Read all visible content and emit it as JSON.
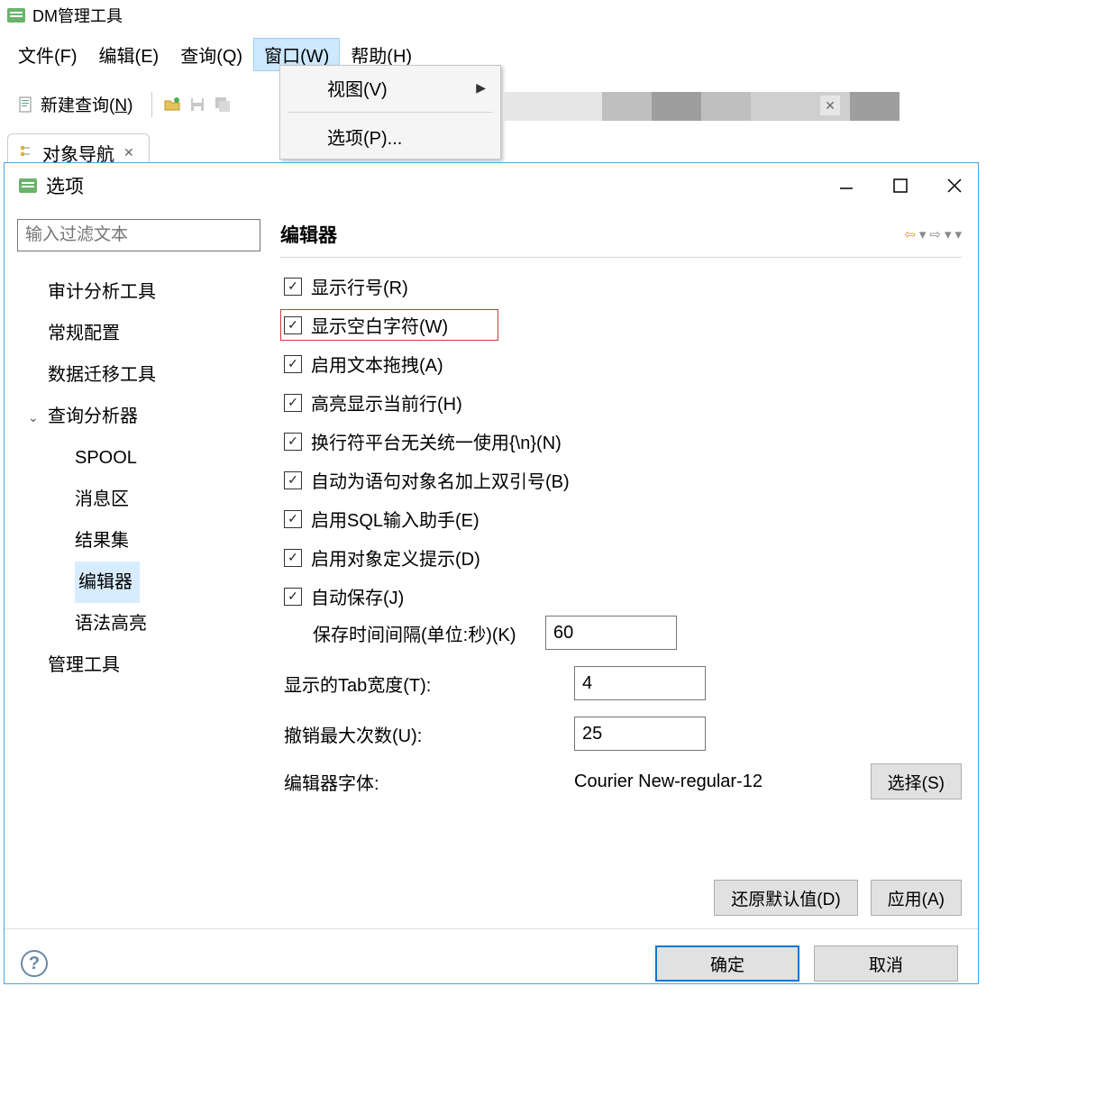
{
  "app": {
    "title": "DM管理工具"
  },
  "menu": {
    "file": "文件(F)",
    "edit": "编辑(E)",
    "query": "查询(Q)",
    "window": "窗口(W)",
    "help": "帮助(H)"
  },
  "toolbar": {
    "new_query_prefix": "新建查询(",
    "new_query_key": "N",
    "new_query_suffix": ")"
  },
  "dropdown": {
    "view": "视图(V)",
    "options": "选项(P)..."
  },
  "nav_tab": {
    "label": "对象导航"
  },
  "dialog": {
    "title": "选项",
    "filter_placeholder": "输入过滤文本",
    "tree": {
      "audit": "审计分析工具",
      "general": "常规配置",
      "migrate": "数据迁移工具",
      "query_analyzer": "查询分析器",
      "spool": "SPOOL",
      "message": "消息区",
      "result": "结果集",
      "editor": "编辑器",
      "syntax": "语法高亮",
      "manage": "管理工具"
    },
    "panel_title": "编辑器",
    "checks": {
      "c1": "显示行号(R)",
      "c2": "显示空白字符(W)",
      "c3": "启用文本拖拽(A)",
      "c4": "高亮显示当前行(H)",
      "c5": "换行符平台无关统一使用{\\n}(N)",
      "c6": "自动为语句对象名加上双引号(B)",
      "c7": "启用SQL输入助手(E)",
      "c8": "启用对象定义提示(D)",
      "c9": "自动保存(J)"
    },
    "save_interval_label": "保存时间间隔(单位:秒)(K)",
    "save_interval_value": "60",
    "tab_width_label": "显示的Tab宽度(T):",
    "tab_width_value": "4",
    "undo_max_label": "撤销最大次数(U):",
    "undo_max_value": "25",
    "font_label": "编辑器字体:",
    "font_value": "Courier New-regular-12",
    "choose_btn": "选择(S)",
    "restore_btn": "还原默认值(D)",
    "apply_btn": "应用(A)",
    "ok_btn": "确定",
    "cancel_btn": "取消"
  }
}
